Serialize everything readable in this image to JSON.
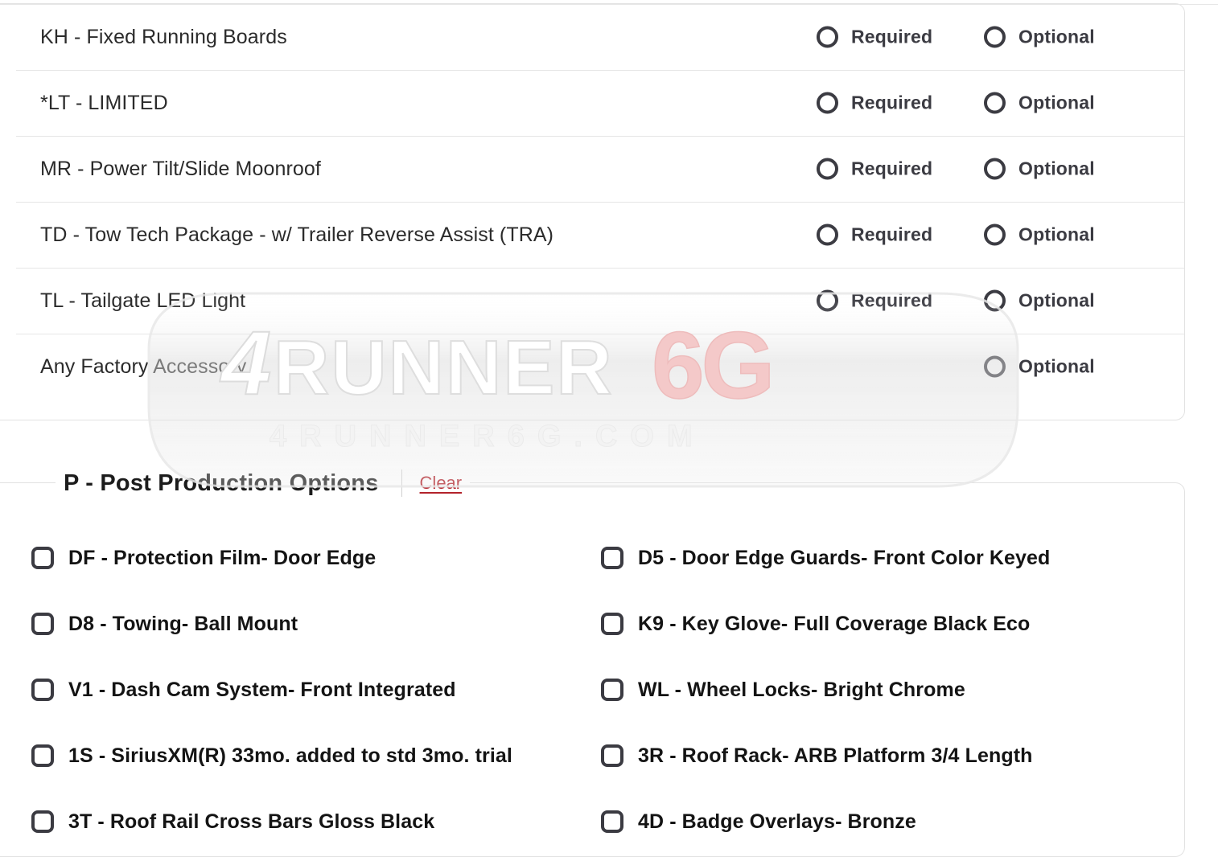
{
  "watermark": {
    "primary_text": "4RUNNER6G",
    "secondary_text": "4RUNNER6G.COM",
    "accent_color": "#f2c3c3"
  },
  "factory_options_panel": {
    "choice_labels": {
      "required": "Required",
      "optional": "Optional"
    },
    "rows": [
      {
        "label": "KH - Fixed Running Boards",
        "required": "Required",
        "optional": "Optional",
        "has_required": true
      },
      {
        "label": "*LT - LIMITED",
        "required": "Required",
        "optional": "Optional",
        "has_required": true
      },
      {
        "label": "MR - Power Tilt/Slide Moonroof",
        "required": "Required",
        "optional": "Optional",
        "has_required": true
      },
      {
        "label": "TD - Tow Tech Package - w/ Trailer Reverse Assist (TRA)",
        "required": "Required",
        "optional": "Optional",
        "has_required": true
      },
      {
        "label": "TL - Tailgate LED Light",
        "required": "Required",
        "optional": "Optional",
        "has_required": true
      },
      {
        "label": "Any Factory Accessory",
        "required": "",
        "optional": "Optional",
        "has_required": false
      }
    ]
  },
  "post_production_panel": {
    "title": "P - Post Production Options",
    "clear_label": "Clear",
    "checkboxes": [
      {
        "label": "DF - Protection Film- Door Edge",
        "checked": false
      },
      {
        "label": "D5 - Door Edge Guards- Front Color Keyed",
        "checked": false
      },
      {
        "label": "D8 - Towing- Ball Mount",
        "checked": false
      },
      {
        "label": "K9 - Key Glove- Full Coverage Black Eco",
        "checked": false
      },
      {
        "label": "V1 - Dash Cam System- Front Integrated",
        "checked": false
      },
      {
        "label": "WL - Wheel Locks- Bright Chrome",
        "checked": false
      },
      {
        "label": "1S - SiriusXM(R) 33mo. added to std 3mo. trial",
        "checked": false
      },
      {
        "label": "3R - Roof Rack- ARB Platform 3/4 Length",
        "checked": false
      },
      {
        "label": "3T - Roof Rail Cross Bars Gloss Black",
        "checked": false
      },
      {
        "label": "4D - Badge Overlays- Bronze",
        "checked": false
      }
    ]
  },
  "colors": {
    "text_primary": "#1c1c1c",
    "text_secondary": "#3b3b42",
    "link_red": "#b3232b",
    "border": "#e2e2e2",
    "separator": "#e6e6e6"
  }
}
